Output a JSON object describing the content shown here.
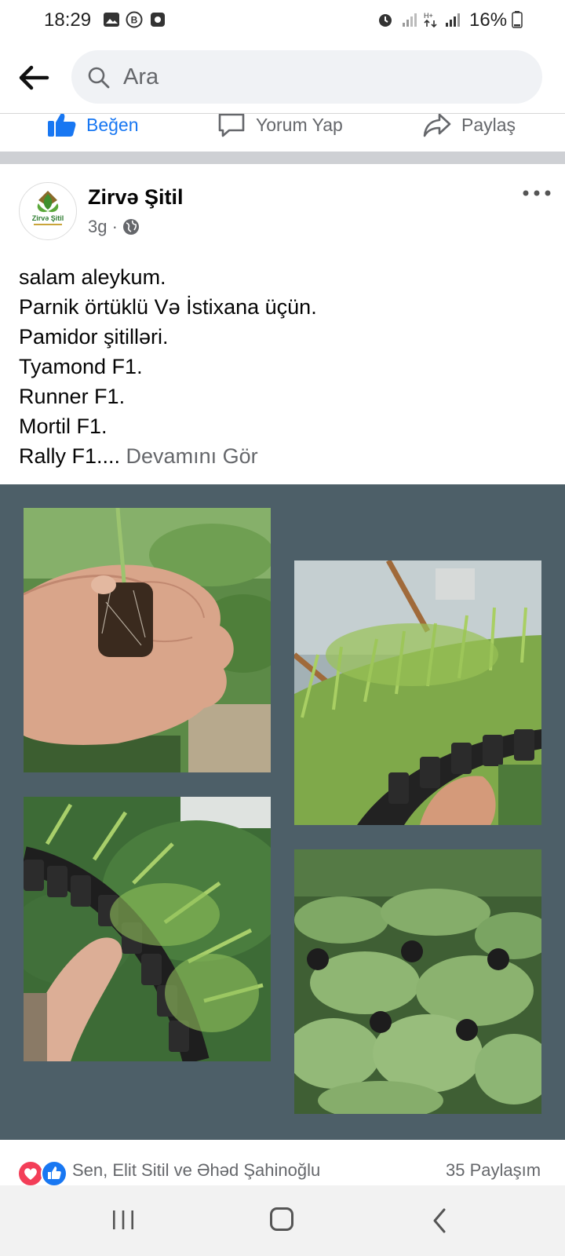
{
  "status_bar": {
    "time": "18:29",
    "battery": "16%",
    "left_icons": [
      "image-icon",
      "b-circle-icon",
      "square-app-icon"
    ],
    "right_icons": [
      "alarm-icon",
      "signal-icon",
      "data-arrows-icon",
      "signal-icon",
      "battery-icon"
    ]
  },
  "header": {
    "back_icon": "arrow-left-icon",
    "search_placeholder": "Ara"
  },
  "prev_post_actions": {
    "like": "Beğen",
    "comment": "Yorum Yap",
    "share": "Paylaş"
  },
  "post": {
    "author": "Zirvə Şitil",
    "avatar_text": "Zirvə Şitil",
    "time": "3g",
    "privacy_icon": "globe-icon",
    "lines": [
      "salam aleykum.",
      "Parnik örtüklü Və İstixana üçün.",
      "Pamidor şitilləri.",
      "Tyamond F1.",
      "Runner F1.",
      "Mortil F1.",
      "Rally F1...."
    ],
    "see_more": "Devamını Gör",
    "photos": [
      "hand-holding-seedling-plug",
      "seedlings-tray-greenhouse",
      "hand-holding-seedling-tray",
      "tomato-seedlings-closeup"
    ],
    "reactions": {
      "icons": [
        "love-icon",
        "like-icon"
      ],
      "text": "Sen, Elit Sitil ve Əhəd Şahinoğlu",
      "shares": "35 Paylaşım"
    }
  },
  "colors": {
    "facebook_blue": "#1877f2",
    "photo_background": "#4d5f68",
    "secondary_text": "#65676b"
  }
}
